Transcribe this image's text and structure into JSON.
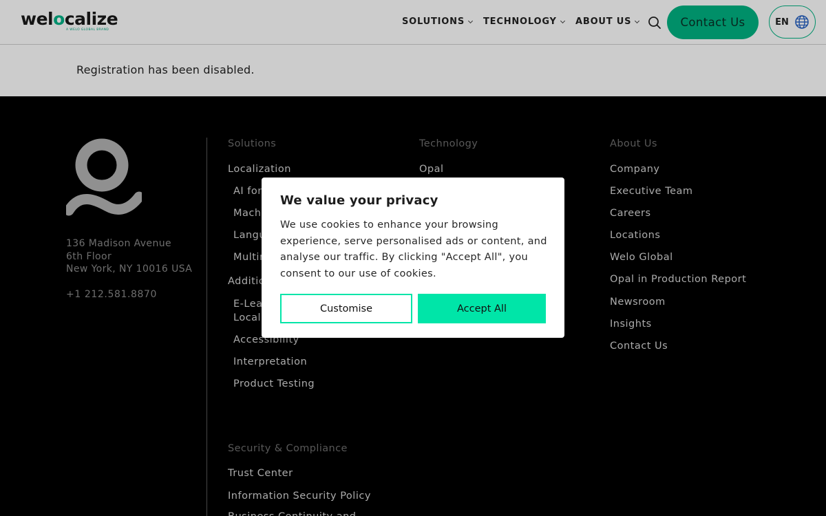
{
  "header": {
    "logo": {
      "part1": "wel",
      "part2": "o",
      "part3": "calize",
      "tagline": "A WELO GLOBAL BRAND"
    },
    "nav": [
      {
        "label": "SOLUTIONS"
      },
      {
        "label": "TECHNOLOGY"
      },
      {
        "label": "ABOUT US"
      }
    ],
    "search_icon": "search-icon",
    "contact_label": "Contact Us",
    "lang_label": "EN",
    "globe_icon": "globe-icon"
  },
  "content": {
    "message": "Registration has been disabled."
  },
  "footer": {
    "address": {
      "line1": "136 Madison Avenue",
      "line2": "6th Floor",
      "line3": "New York, NY 10016 USA"
    },
    "phone": "+1 212.581.8870",
    "solutions": {
      "heading": "Solutions",
      "items": [
        "Localization",
        "AI for",
        "Machi",
        "Langu",
        "Multin",
        "Additio",
        "E-Lear",
        "Locali",
        "Accessibility",
        "Interpretation",
        "Product Testing"
      ]
    },
    "technology": {
      "heading": "Technology",
      "items": [
        "Opal"
      ]
    },
    "about": {
      "heading": "About Us",
      "items": [
        "Company",
        "Executive Team",
        "Careers",
        "Locations",
        "Welo Global",
        "Opal in Production Report",
        "Newsroom",
        "Insights",
        "Contact Us"
      ]
    },
    "security": {
      "heading": "Security & Compliance",
      "items": [
        "Trust Center",
        "Information Security Policy",
        "Business Continuity and"
      ]
    }
  },
  "cookie_modal": {
    "title": "We value your privacy",
    "body": "We use cookies to enhance your browsing experience, serve personalised ads or content, and analyse our traffic. By clicking \"Accept All\", you consent to our use of cookies.",
    "customise_label": "Customise",
    "accept_label": "Accept All"
  },
  "colors": {
    "brand_green": "#00b383",
    "accent_green": "#00e5a8",
    "footer_bg": "#000000"
  }
}
